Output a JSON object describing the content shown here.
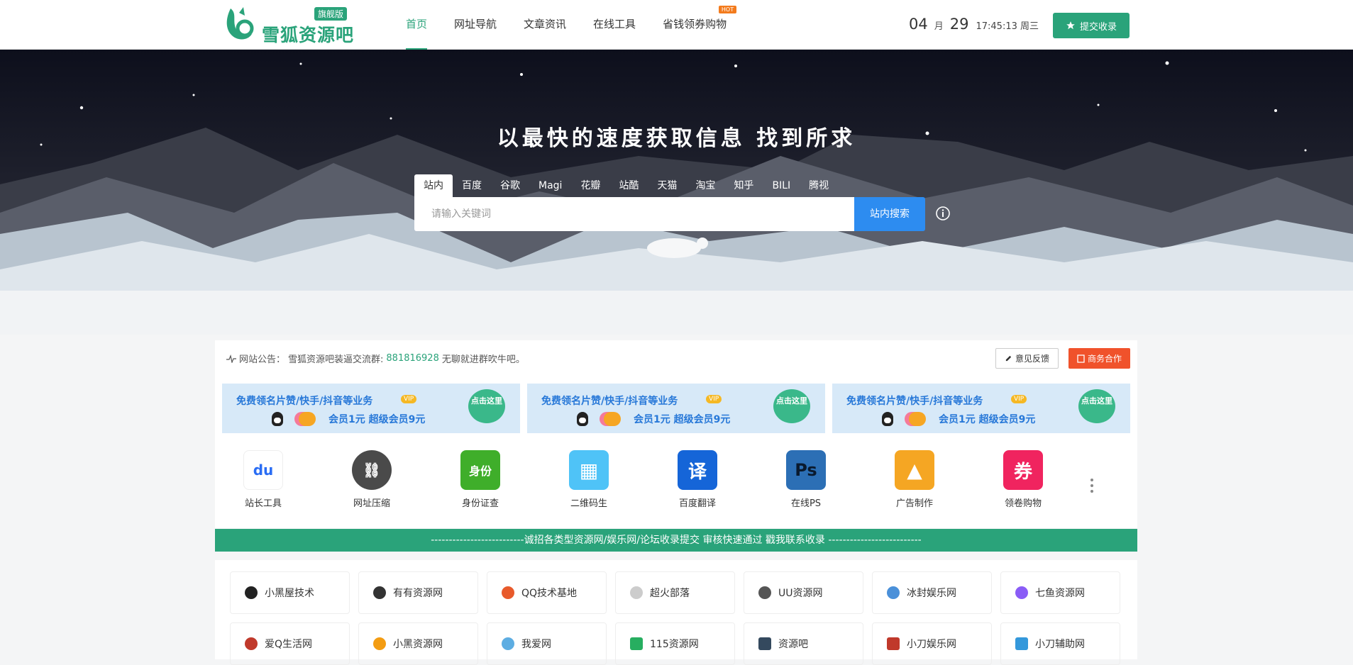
{
  "header": {
    "logo_text": "雪狐资源吧",
    "logo_badge": "旗舰版",
    "nav": [
      {
        "label": "首页",
        "active": true
      },
      {
        "label": "网址导航"
      },
      {
        "label": "文章资讯"
      },
      {
        "label": "在线工具"
      },
      {
        "label": "省钱领券购物",
        "badge": "HOT"
      }
    ],
    "date": {
      "month": "04",
      "month_unit": "月",
      "day": "29",
      "time": "17:45:13 周三"
    },
    "submit_label": "提交收录"
  },
  "banner": {
    "slogan": "以最快的速度获取信息 找到所求",
    "tabs": [
      "站内",
      "百度",
      "谷歌",
      "Magi",
      "花瓣",
      "站酷",
      "天猫",
      "淘宝",
      "知乎",
      "BILI",
      "腾视"
    ],
    "search_placeholder": "请输入关键词",
    "search_button": "站内搜索"
  },
  "notice": {
    "label": "网站公告：",
    "text_before": "雪狐资源吧装逼交流群:",
    "group_number": "881816928",
    "text_after": "无聊就进群吹牛吧。",
    "feedback_label": "意见反馈",
    "business_label": "商务合作"
  },
  "ads": [
    {
      "line1": "免费领名片赞/快手/抖音等业务",
      "vip": "VIP",
      "line2": "会员1元 超级会员9元",
      "bubble": "点击这里"
    },
    {
      "line1": "免费领名片赞/快手/抖音等业务",
      "vip": "VIP",
      "line2": "会员1元 超级会员9元",
      "bubble": "点击这里"
    },
    {
      "line1": "免费领名片赞/快手/抖音等业务",
      "vip": "VIP",
      "line2": "会员1元 超级会员9元",
      "bubble": "点击这里"
    }
  ],
  "apps": [
    {
      "label": "站长工具",
      "icon": "baidu-paw-icon",
      "glyph": "du",
      "color": "#ffffff"
    },
    {
      "label": "网址压缩",
      "icon": "link-icon",
      "glyph": "⛓",
      "color": "#4a4a4a"
    },
    {
      "label": "身份证查",
      "icon": "id-card-icon",
      "glyph": "身份",
      "color": "#3fae2a"
    },
    {
      "label": "二维码生",
      "icon": "qrcode-icon",
      "glyph": "▦",
      "color": "#4fc3f7"
    },
    {
      "label": "百度翻译",
      "icon": "translate-icon",
      "glyph": "译",
      "color": "#1565d8"
    },
    {
      "label": "在线PS",
      "icon": "photoshop-icon",
      "glyph": "Ps",
      "color": "#2c6fb5"
    },
    {
      "label": "广告制作",
      "icon": "image-icon",
      "glyph": "▲",
      "color": "#f5a623"
    },
    {
      "label": "领卷购物",
      "icon": "coupon-icon",
      "glyph": "券",
      "color": "#f0245f"
    }
  ],
  "strip_text": "--------------------------诚招各类型资源网/娱乐网/论坛收录提交 审核快速通过 戳我联系收录 --------------------------",
  "sites": [
    {
      "label": "小黑屋技术",
      "icon": "xiaoheiwu-icon",
      "color": "#222222"
    },
    {
      "label": "有有资源网",
      "icon": "youyou-icon",
      "color": "#333333"
    },
    {
      "label": "QQ技术基地",
      "icon": "qq-base-icon",
      "color": "#e85a2b"
    },
    {
      "label": "超火部落",
      "icon": "chaohuo-icon",
      "color": "#cccccc"
    },
    {
      "label": "UU资源网",
      "icon": "uu-icon",
      "color": "#555555"
    },
    {
      "label": "冰封娱乐网",
      "icon": "bingfeng-icon",
      "color": "#4a90d9"
    },
    {
      "label": "七鱼资源网",
      "icon": "qiyu-icon",
      "color": "#8a5cf6"
    },
    {
      "label": "爱Q生活网",
      "icon": "aiq-icon",
      "color": "#c0392b"
    },
    {
      "label": "小黑资源网",
      "icon": "xiaohei-icon",
      "color": "#f39c12"
    },
    {
      "label": "我爱网",
      "icon": "woai-icon",
      "color": "#5dade2"
    },
    {
      "label": "115资源网",
      "icon": "ziyuan115-icon",
      "color": "#27ae60"
    },
    {
      "label": "资源吧",
      "icon": "ziyuanba-icon",
      "color": "#34495e"
    },
    {
      "label": "小刀娱乐网",
      "icon": "xiaodao-icon",
      "color": "#c0392b"
    },
    {
      "label": "小刀辅助网",
      "icon": "xiaodao-fuzhu-icon",
      "color": "#3498db"
    }
  ]
}
